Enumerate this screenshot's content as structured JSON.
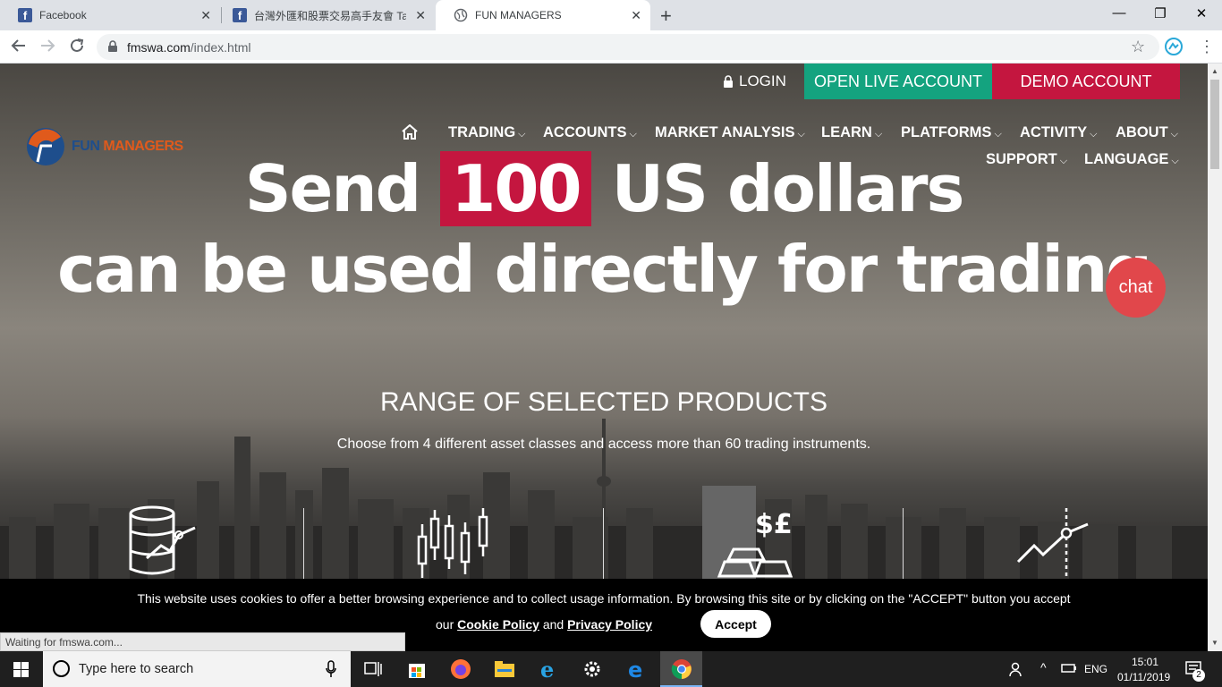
{
  "browser": {
    "tabs": [
      {
        "title": "Facebook",
        "favicon": "facebook-icon"
      },
      {
        "title": "台灣外匯和股票交易高手友會 Ta",
        "favicon": "facebook-icon"
      },
      {
        "title": "FUN MANAGERS",
        "favicon": "globe-icon"
      }
    ],
    "new_tab": "+",
    "url_host": "fmswa.com",
    "url_path": "/index.html",
    "status": "Waiting for fmswa.com..."
  },
  "site": {
    "login": "LOGIN",
    "open_live": "OPEN LIVE ACCOUNT",
    "demo": "DEMO ACCOUNT",
    "logo_part1": "FUN",
    "logo_part2": " MANAGERS",
    "nav": [
      "TRADING",
      "ACCOUNTS",
      "MARKET ANALYSIS",
      "LEARN",
      "PLATFORMS",
      "ACTIVITY",
      "ABOUT",
      "SUPPORT",
      "LANGUAGE"
    ],
    "headline_pre": "Send ",
    "headline_highlight": "100",
    "headline_post": " US dollars",
    "headline_line2": "can be used directly for trading",
    "chat": "chat",
    "range_title": "RANGE OF SELECTED PRODUCTS",
    "range_sub": "Choose from 4 different asset classes and access more than 60 trading instruments.",
    "colors": {
      "green": "#14a37f",
      "red": "#c4163f",
      "chat": "#e1474b"
    }
  },
  "cookie": {
    "text": "This website uses cookies to offer a better browsing experience and to collect usage information. By browsing this site or by clicking on the \"ACCEPT\" button you accept",
    "our": "our ",
    "cookie_policy": "Cookie Policy",
    "and": " and ",
    "privacy_policy": "Privacy Policy",
    "accept": "Accept"
  },
  "taskbar": {
    "search_placeholder": "Type here to search",
    "lang": "ENG",
    "time": "15:01",
    "date": "01/11/2019",
    "notif_count": "2"
  }
}
